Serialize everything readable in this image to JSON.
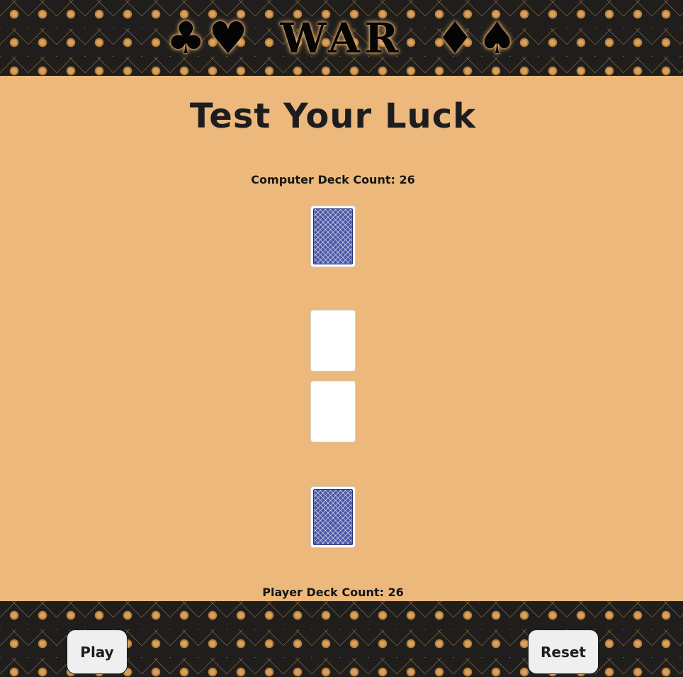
{
  "header": {
    "suit_left_1": "♣",
    "suit_left_2": "♥",
    "title": "WAR",
    "suit_right_1": "♦",
    "suit_right_2": "♠"
  },
  "main": {
    "title": "Test Your Luck"
  },
  "computer": {
    "deck_count_label": "Computer Deck Count: 26"
  },
  "player": {
    "deck_count_label": "Player Deck Count: 26"
  },
  "controls": {
    "play_label": "Play",
    "reset_label": "Reset"
  },
  "colors": {
    "background": "#ecb87c",
    "band": "#1f1e1c",
    "card_back": "#4b56a6"
  }
}
